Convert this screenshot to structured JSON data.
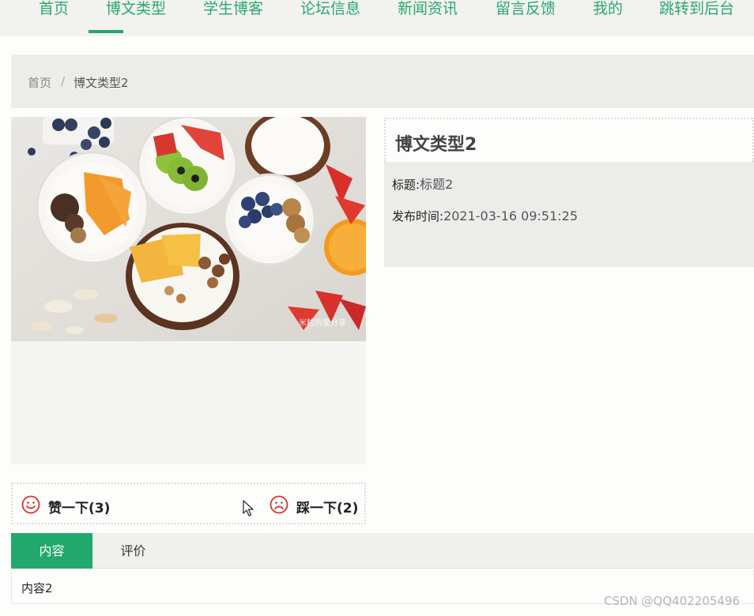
{
  "nav": {
    "items": [
      {
        "label": "首页"
      },
      {
        "label": "博文类型"
      },
      {
        "label": "学生博客"
      },
      {
        "label": "论坛信息"
      },
      {
        "label": "新闻资讯"
      },
      {
        "label": "留言反馈"
      },
      {
        "label": "我的"
      },
      {
        "label": "跳转到后台"
      }
    ],
    "active_index": 1,
    "accent_color": "#22a86c"
  },
  "breadcrumb": {
    "home": "首页",
    "separator": "/",
    "current": "博文类型2"
  },
  "article": {
    "title": "博文类型2",
    "image_watermark": "米粒的爱分享",
    "fields": [
      {
        "label": "标题:",
        "value": "标题2"
      },
      {
        "label": "发布时间:",
        "value": "2021-03-16 09:51:25"
      }
    ]
  },
  "votes": {
    "like_label": "赞一下(3)",
    "dislike_label": "踩一下(2)",
    "icon_color": "#d9352a"
  },
  "tabs": {
    "items": [
      {
        "label": "内容"
      },
      {
        "label": "评价"
      }
    ],
    "active_index": 0,
    "content_text": "内容2"
  },
  "watermark": "CSDN @QQ402205496"
}
